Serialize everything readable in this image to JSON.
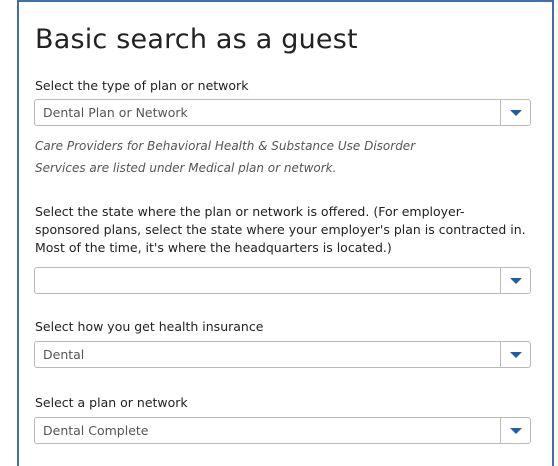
{
  "page": {
    "title": "Basic search as a guest"
  },
  "fields": {
    "plan_type": {
      "label": "Select the type of plan or network",
      "value": "Dental Plan or Network",
      "note_line1": "Care Providers for Behavioral Health & Substance Use Disorder",
      "note_line2": "Services are listed under Medical plan or network."
    },
    "state": {
      "label_line1": "Select the state where the plan or network is offered. (For employer-",
      "label_line2": "sponsored plans, select the state where your employer's plan is contracted in.",
      "label_line3": "Most of the time, it's where the headquarters is located.)",
      "value": ""
    },
    "insurance_source": {
      "label": "Select how you get health insurance",
      "value": "Dental"
    },
    "plan": {
      "label": "Select a plan or network",
      "value": "Dental Complete"
    }
  },
  "colors": {
    "border_accent": "#3f6fae",
    "dropdown_arrow": "#1f5fa8"
  }
}
